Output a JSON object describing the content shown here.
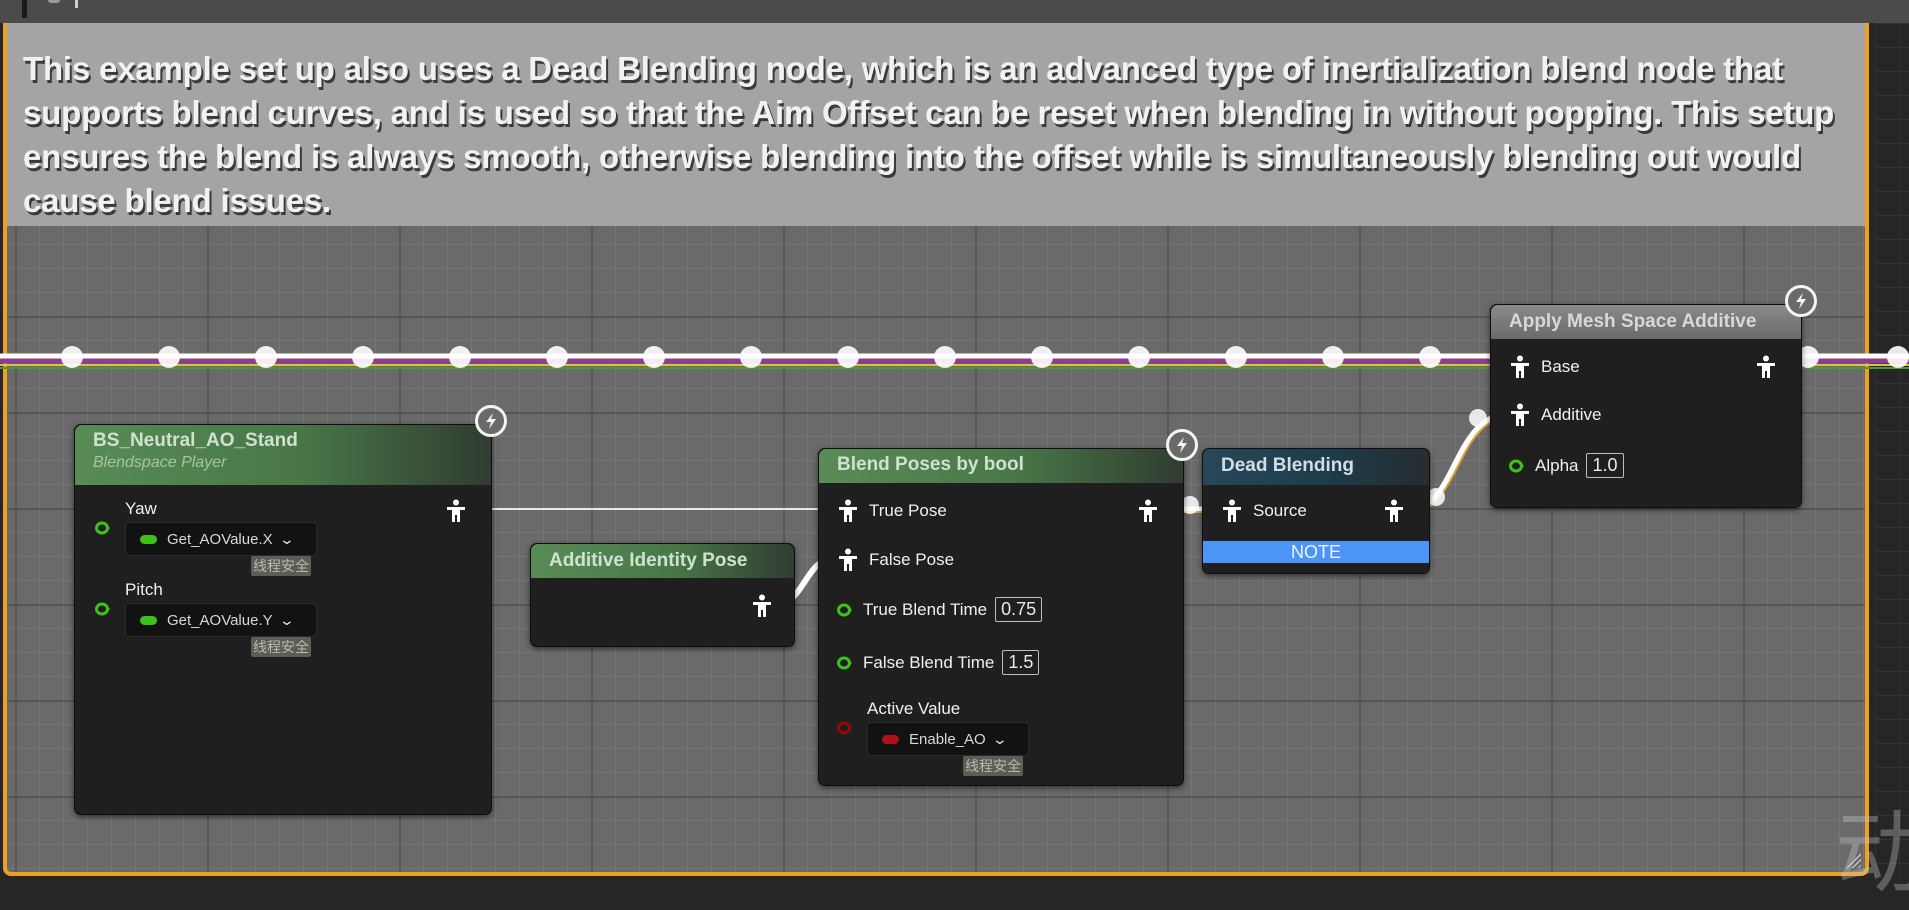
{
  "comment": {
    "text": "This example set up also uses a Dead Blending node, which is an advanced type of inertialization blend node that supports blend curves, and is used so that the Aim Offset can be reset when blending in without popping. This setup ensures the blend is always smooth, otherwise blending into the offset while is simultaneously blending out would cause blend issues.",
    "border_color": "#f0a020"
  },
  "nodes": {
    "blendspace": {
      "title": "BS_Neutral_AO_Stand",
      "subtitle": "Blendspace Player",
      "pins": [
        {
          "label": "Yaw",
          "binding": "Get_AOValue.X",
          "badge": "线程安全",
          "type": "float"
        },
        {
          "label": "Pitch",
          "binding": "Get_AOValue.Y",
          "badge": "线程安全",
          "type": "float"
        }
      ],
      "output_pin": "pose-output-icon"
    },
    "additive_identity": {
      "title": "Additive Identity Pose",
      "output_pin": "pose-output-icon"
    },
    "blend_by_bool": {
      "title": "Blend Poses by bool",
      "pins": [
        {
          "label": "True Pose",
          "type": "pose"
        },
        {
          "label": "False Pose",
          "type": "pose"
        },
        {
          "label": "True Blend Time",
          "value": "0.75",
          "type": "float"
        },
        {
          "label": "False Blend Time",
          "value": "1.5",
          "type": "float"
        },
        {
          "label": "Active Value",
          "binding": "Enable_AO",
          "badge": "线程安全",
          "type": "bool"
        }
      ]
    },
    "dead_blending": {
      "title": "Dead Blending",
      "pins": [
        {
          "label": "Source",
          "type": "pose"
        }
      ],
      "note_label": "NOTE"
    },
    "apply_mesh_space_additive": {
      "title": "Apply Mesh Space Additive",
      "pins": [
        {
          "label": "Base",
          "type": "pose"
        },
        {
          "label": "Additive",
          "type": "pose"
        },
        {
          "label": "Alpha",
          "value": "1.0",
          "type": "float"
        }
      ]
    }
  },
  "icons": {
    "fast_path": "lightning-bolt-icon",
    "pose": "pose-pin-icon",
    "float": "float-pin-icon",
    "bool": "bool-pin-icon"
  },
  "colors": {
    "float_pin": "#3ec21a",
    "bool_pin": "#8e0a0a",
    "note_bar": "#4c94f5",
    "exec_wire_purple": "#8a3f8e",
    "exec_wire_yellow": "#e0c040"
  },
  "watermark": "动"
}
